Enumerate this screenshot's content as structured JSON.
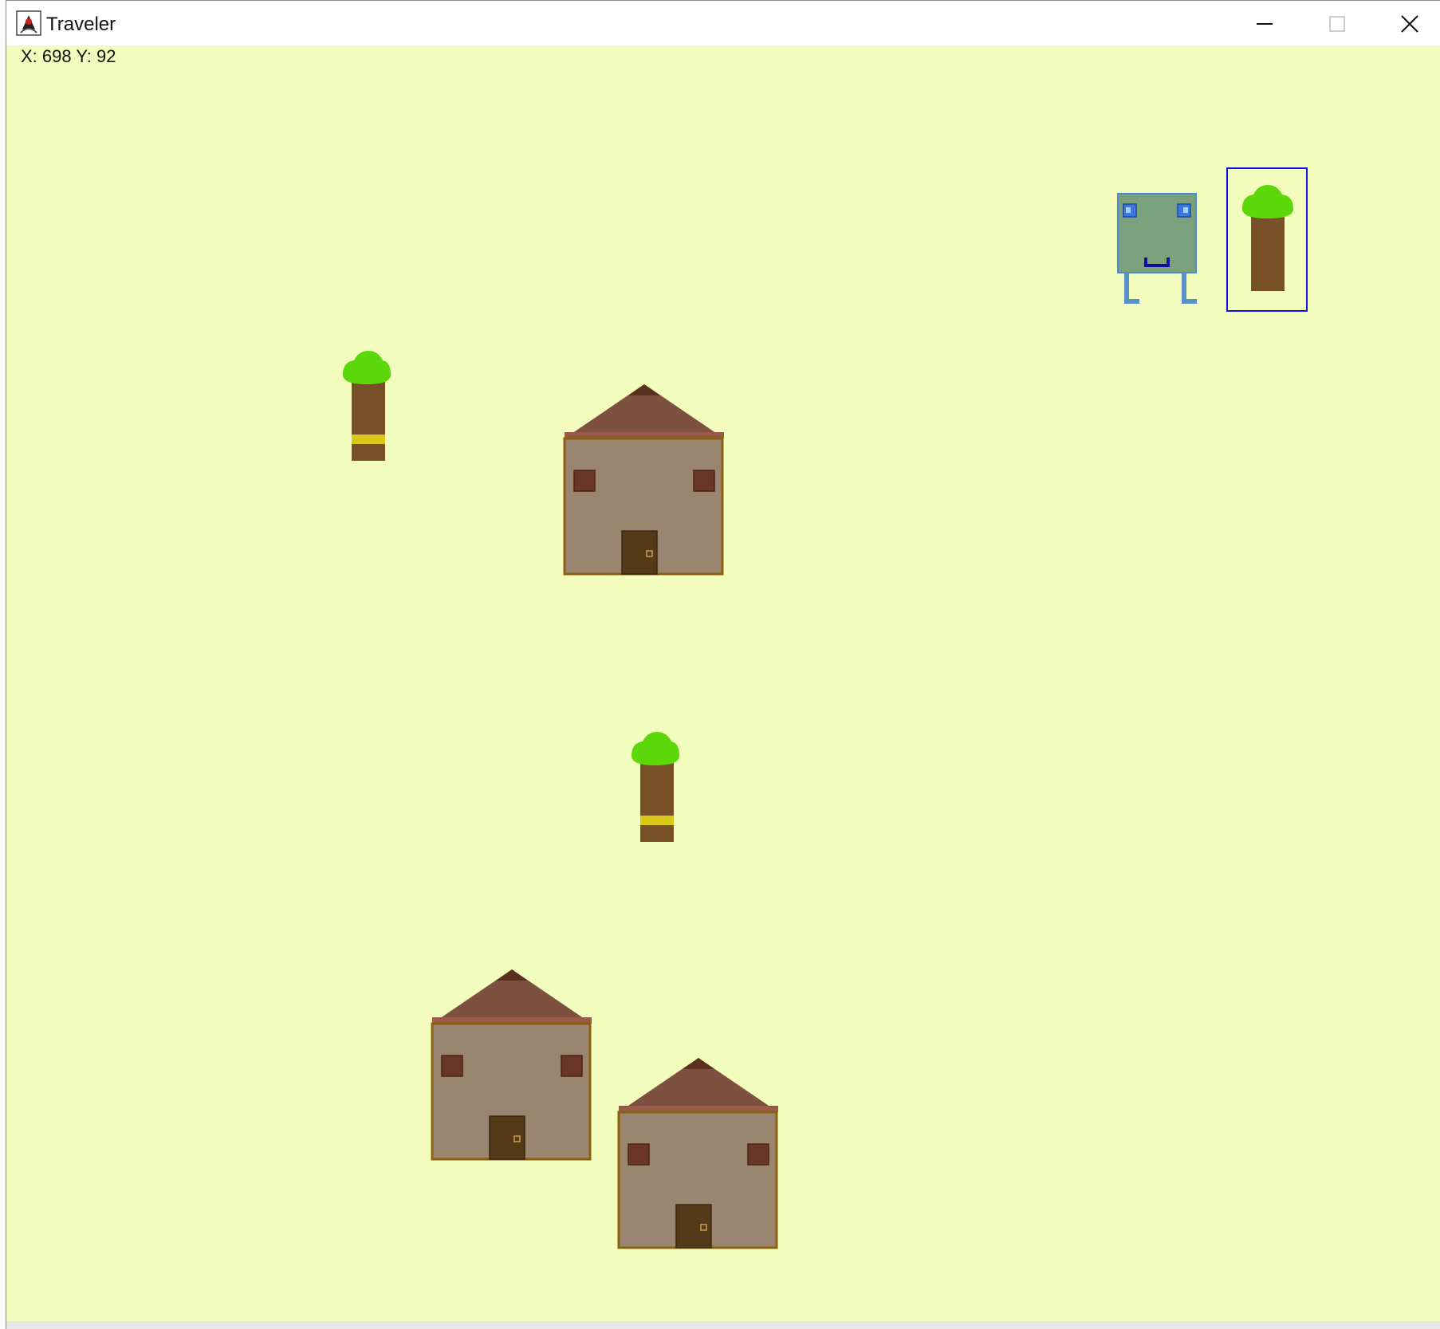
{
  "window": {
    "title": "Traveler",
    "app_icon": "java-duke-icon",
    "controls": [
      {
        "name": "minimize",
        "icon": "minimize-icon"
      },
      {
        "name": "maximize",
        "icon": "maximize-icon"
      },
      {
        "name": "close",
        "icon": "close-icon"
      }
    ]
  },
  "hud": {
    "coordinates": "X: 698 Y: 92"
  },
  "scene": {
    "background_color": "#f2fcbc",
    "objects": [
      {
        "type": "player",
        "color": "#7aa17c",
        "outline": "#4a8ad8"
      },
      {
        "type": "tree",
        "selected": true
      },
      {
        "type": "tree",
        "ring": true
      },
      {
        "type": "tree",
        "ring": true
      },
      {
        "type": "house"
      },
      {
        "type": "house"
      },
      {
        "type": "house"
      }
    ]
  },
  "colors": {
    "tree_leaves": "#5cd80a",
    "tree_trunk": "#785028",
    "house_wall": "#9a8670",
    "house_roof": "#7d5040",
    "house_outline": "#8a6010",
    "selection": "#1010e0"
  }
}
